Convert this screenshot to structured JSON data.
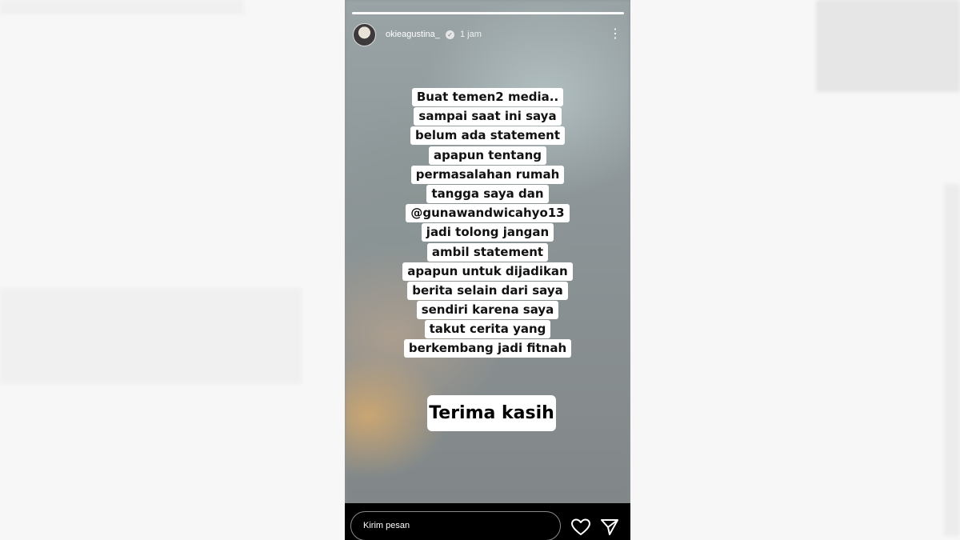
{
  "story": {
    "username": "okieagustina_",
    "time_ago": "1 jam",
    "message_lines": [
      "Buat temen2 media..",
      "sampai saat ini saya",
      "belum ada statement",
      "apapun tentang",
      "permasalahan rumah",
      "tangga saya dan",
      "@gunawandwicahyo13",
      "jadi tolong jangan",
      "ambil statement",
      "apapun untuk dijadikan",
      "berita selain dari saya",
      "sendiri karena saya",
      "takut cerita yang",
      "berkembang jadi fitnah"
    ],
    "closing": "Terima kasih",
    "reply_placeholder": "Kirim pesan",
    "icons": [
      "more-options-icon",
      "verified-badge-icon",
      "heart-icon",
      "send-icon"
    ]
  }
}
